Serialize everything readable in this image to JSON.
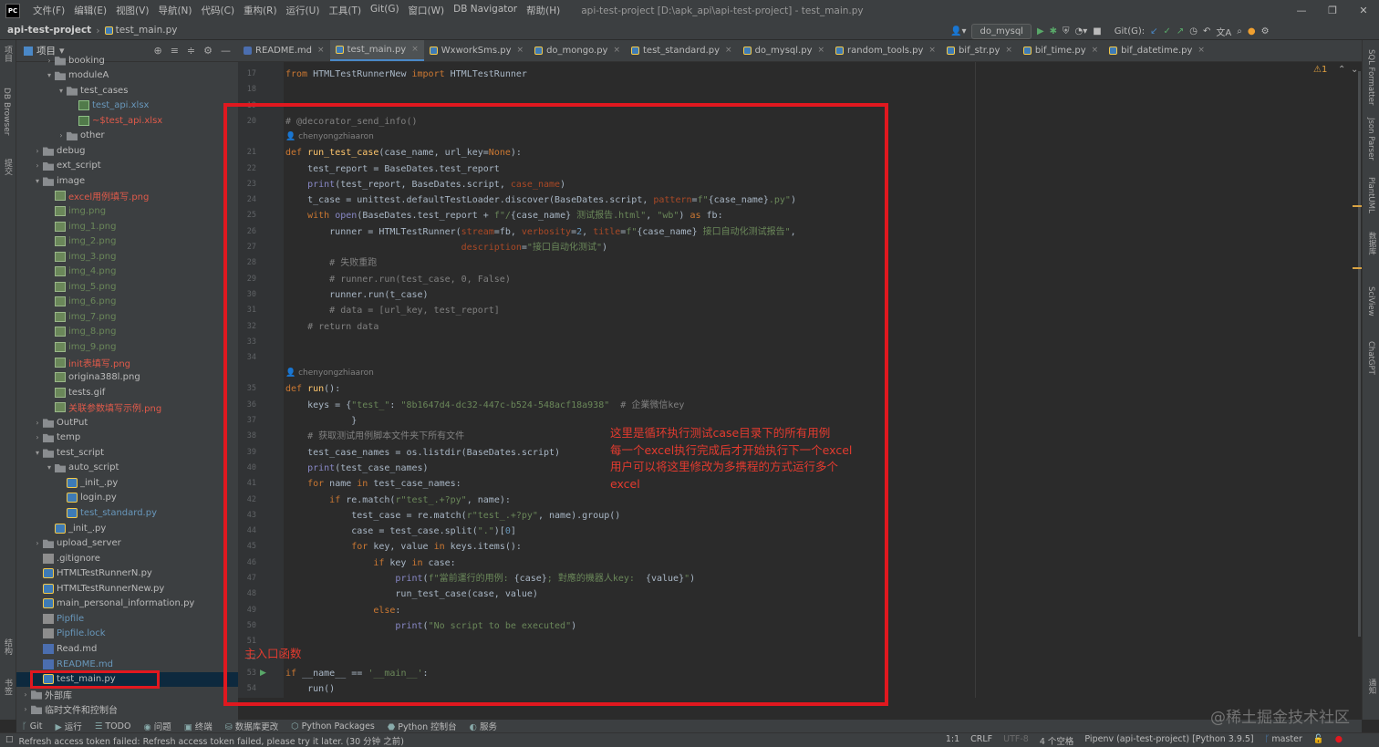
{
  "menubar": {
    "logo": "PC",
    "items": [
      "文件(F)",
      "编辑(E)",
      "视图(V)",
      "导航(N)",
      "代码(C)",
      "重构(R)",
      "运行(U)",
      "工具(T)",
      "Git(G)",
      "窗口(W)",
      "DB Navigator",
      "帮助(H)"
    ],
    "window_title": "api-test-project [D:\\apk_api\\api-test-project] - test_main.py"
  },
  "navbar": {
    "project": "api-test-project",
    "file": "test_main.py"
  },
  "toolbar_right": {
    "run_config": "do_mysql",
    "git_label": "Git(G):"
  },
  "left_strip": {
    "items": [
      "项目",
      "DB Browser",
      "提交",
      "结构",
      "书签"
    ]
  },
  "project_panel": {
    "title": "项目",
    "tree": [
      {
        "label": "booking",
        "icon": "folder",
        "depth": 2,
        "arrow": ">",
        "color": "#bbbbbb"
      },
      {
        "label": "moduleA",
        "icon": "folder",
        "depth": 2,
        "arrow": "v",
        "color": "#bbbbbb"
      },
      {
        "label": "test_cases",
        "icon": "folder",
        "depth": 3,
        "arrow": "v",
        "color": "#bbbbbb"
      },
      {
        "label": "test_api.xlsx",
        "icon": "xls",
        "depth": 4,
        "arrow": "",
        "color": "#6897bb"
      },
      {
        "label": "~$test_api.xlsx",
        "icon": "xls",
        "depth": 4,
        "arrow": "",
        "color": "#e05a4a"
      },
      {
        "label": "other",
        "icon": "folder",
        "depth": 3,
        "arrow": ">",
        "color": "#bbbbbb"
      },
      {
        "label": "debug",
        "icon": "folder",
        "depth": 1,
        "arrow": ">",
        "color": "#bbbbbb"
      },
      {
        "label": "ext_script",
        "icon": "folder",
        "depth": 1,
        "arrow": ">",
        "color": "#bbbbbb"
      },
      {
        "label": "image",
        "icon": "folder",
        "depth": 1,
        "arrow": "v",
        "color": "#bbbbbb"
      },
      {
        "label": "excel用例填写.png",
        "icon": "img",
        "depth": 2,
        "arrow": "",
        "color": "#e05a4a"
      },
      {
        "label": "img.png",
        "icon": "img",
        "depth": 2,
        "arrow": "",
        "color": "#6a8759"
      },
      {
        "label": "img_1.png",
        "icon": "img",
        "depth": 2,
        "arrow": "",
        "color": "#6a8759"
      },
      {
        "label": "img_2.png",
        "icon": "img",
        "depth": 2,
        "arrow": "",
        "color": "#6a8759"
      },
      {
        "label": "img_3.png",
        "icon": "img",
        "depth": 2,
        "arrow": "",
        "color": "#6a8759"
      },
      {
        "label": "img_4.png",
        "icon": "img",
        "depth": 2,
        "arrow": "",
        "color": "#6a8759"
      },
      {
        "label": "img_5.png",
        "icon": "img",
        "depth": 2,
        "arrow": "",
        "color": "#6a8759"
      },
      {
        "label": "img_6.png",
        "icon": "img",
        "depth": 2,
        "arrow": "",
        "color": "#6a8759"
      },
      {
        "label": "img_7.png",
        "icon": "img",
        "depth": 2,
        "arrow": "",
        "color": "#6a8759"
      },
      {
        "label": "img_8.png",
        "icon": "img",
        "depth": 2,
        "arrow": "",
        "color": "#6a8759"
      },
      {
        "label": "img_9.png",
        "icon": "img",
        "depth": 2,
        "arrow": "",
        "color": "#6a8759"
      },
      {
        "label": "init表填写.png",
        "icon": "img",
        "depth": 2,
        "arrow": "",
        "color": "#e05a4a"
      },
      {
        "label": "origina388l.png",
        "icon": "img",
        "depth": 2,
        "arrow": "",
        "color": "#bbbbbb"
      },
      {
        "label": "tests.gif",
        "icon": "img",
        "depth": 2,
        "arrow": "",
        "color": "#bbbbbb"
      },
      {
        "label": "关联参数填写示例.png",
        "icon": "img",
        "depth": 2,
        "arrow": "",
        "color": "#e05a4a"
      },
      {
        "label": "OutPut",
        "icon": "folder",
        "depth": 1,
        "arrow": ">",
        "color": "#bbbbbb"
      },
      {
        "label": "temp",
        "icon": "folder",
        "depth": 1,
        "arrow": ">",
        "color": "#bbbbbb"
      },
      {
        "label": "test_script",
        "icon": "folder",
        "depth": 1,
        "arrow": "v",
        "color": "#bbbbbb"
      },
      {
        "label": "auto_script",
        "icon": "folder",
        "depth": 2,
        "arrow": "v",
        "color": "#bbbbbb"
      },
      {
        "label": "_init_.py",
        "icon": "py",
        "depth": 3,
        "arrow": "",
        "color": "#bbbbbb"
      },
      {
        "label": "login.py",
        "icon": "py",
        "depth": 3,
        "arrow": "",
        "color": "#bbbbbb"
      },
      {
        "label": "test_standard.py",
        "icon": "py",
        "depth": 3,
        "arrow": "",
        "color": "#6897bb"
      },
      {
        "label": "_init_.py",
        "icon": "py",
        "depth": 2,
        "arrow": "",
        "color": "#bbbbbb"
      },
      {
        "label": "upload_server",
        "icon": "folder",
        "depth": 1,
        "arrow": ">",
        "color": "#bbbbbb"
      },
      {
        "label": ".gitignore",
        "icon": "txt",
        "depth": 1,
        "arrow": "",
        "color": "#bbbbbb"
      },
      {
        "label": "HTMLTestRunnerN.py",
        "icon": "py",
        "depth": 1,
        "arrow": "",
        "color": "#bbbbbb"
      },
      {
        "label": "HTMLTestRunnerNew.py",
        "icon": "py",
        "depth": 1,
        "arrow": "",
        "color": "#bbbbbb"
      },
      {
        "label": "main_personal_information.py",
        "icon": "py",
        "depth": 1,
        "arrow": "",
        "color": "#bbbbbb"
      },
      {
        "label": "Pipfile",
        "icon": "txt",
        "depth": 1,
        "arrow": "",
        "color": "#6897bb"
      },
      {
        "label": "Pipfile.lock",
        "icon": "txt",
        "depth": 1,
        "arrow": "",
        "color": "#6897bb"
      },
      {
        "label": "Read.md",
        "icon": "md",
        "depth": 1,
        "arrow": "",
        "color": "#bbbbbb"
      },
      {
        "label": "README.md",
        "icon": "md",
        "depth": 1,
        "arrow": "",
        "color": "#6897bb"
      },
      {
        "label": "test_main.py",
        "icon": "py",
        "depth": 1,
        "arrow": "",
        "color": "#bbbbbb",
        "selected": true
      },
      {
        "label": "外部库",
        "icon": "folder",
        "depth": 0,
        "arrow": ">",
        "color": "#bbbbbb"
      },
      {
        "label": "临时文件和控制台",
        "icon": "folder",
        "depth": 0,
        "arrow": ">",
        "color": "#bbbbbb"
      }
    ]
  },
  "tabs": [
    {
      "label": "README.md",
      "kind": "md",
      "active": false
    },
    {
      "label": "test_main.py",
      "kind": "py",
      "active": true
    },
    {
      "label": "WxworkSms.py",
      "kind": "py",
      "active": false
    },
    {
      "label": "do_mongo.py",
      "kind": "py",
      "active": false
    },
    {
      "label": "test_standard.py",
      "kind": "py",
      "active": false
    },
    {
      "label": "do_mysql.py",
      "kind": "py",
      "active": false
    },
    {
      "label": "random_tools.py",
      "kind": "py",
      "active": false
    },
    {
      "label": "bif_str.py",
      "kind": "py",
      "active": false
    },
    {
      "label": "bif_time.py",
      "kind": "py",
      "active": false
    },
    {
      "label": "bif_datetime.py",
      "kind": "py",
      "active": false
    }
  ],
  "editor": {
    "inspection": "⚠1",
    "lines": [
      {
        "n": "17",
        "html": "<span class=\"kw\">from</span> HTMLTestRunnerNew <span class=\"kw\">import</span> HTMLTestRunner",
        "cls": ""
      },
      {
        "n": "18",
        "html": "",
        "cls": ""
      },
      {
        "n": "19",
        "html": "",
        "cls": ""
      },
      {
        "n": "20",
        "html": "# @decorator_send_info()",
        "cls": "cm"
      },
      {
        "n": "",
        "html": "👤 chenyongzhiaaron",
        "cls": "au"
      },
      {
        "n": "21",
        "html": "<span class=\"kw\">def</span> <span class=\"fn\">run_test_case</span>(case_name, url_key=<span class=\"kw\">None</span>):",
        "cls": ""
      },
      {
        "n": "22",
        "html": "    test_report = BaseDates.test_report",
        "cls": ""
      },
      {
        "n": "23",
        "html": "    <span class=\"bi\">print</span>(test_report, BaseDates.script, <span class=\"pm\">case_name</span>)",
        "cls": ""
      },
      {
        "n": "24",
        "html": "    t_case = unittest.defaultTestLoader.discover(BaseDates.script, <span class=\"pm\">pattern</span>=<span class=\"st\">f\"</span>{case_name}<span class=\"st\">.py\"</span>)",
        "cls": ""
      },
      {
        "n": "25",
        "html": "    <span class=\"kw\">with</span> <span class=\"bi\">open</span>(BaseDates.test_report + <span class=\"st\">f\"/</span>{case_name}<span class=\"st\"> 测试报告.html\"</span>, <span class=\"st\">\"wb\"</span>) <span class=\"kw\">as</span> fb:",
        "cls": ""
      },
      {
        "n": "26",
        "html": "        runner = HTMLTestRunner(<span class=\"pm\">stream</span>=fb, <span class=\"pm\">verbosity</span>=<span class=\"nm\">2</span>, <span class=\"pm\">title</span>=<span class=\"st\">f\"</span>{case_name}<span class=\"st\"> 接口自动化测试报告\"</span>,",
        "cls": ""
      },
      {
        "n": "27",
        "html": "                                <span class=\"pm\">description</span>=<span class=\"st\">\"接口自动化测试\"</span>)",
        "cls": ""
      },
      {
        "n": "28",
        "html": "        # 失败重跑",
        "cls": "cm"
      },
      {
        "n": "29",
        "html": "        # runner.run(test_case, 0, False)",
        "cls": "cm"
      },
      {
        "n": "30",
        "html": "        runner.run(t_case)",
        "cls": ""
      },
      {
        "n": "31",
        "html": "        # data = [url_key, test_report]",
        "cls": "cm"
      },
      {
        "n": "32",
        "html": "    # return data",
        "cls": "cm"
      },
      {
        "n": "33",
        "html": "",
        "cls": ""
      },
      {
        "n": "34",
        "html": "",
        "cls": ""
      },
      {
        "n": "",
        "html": "👤 chenyongzhiaaron",
        "cls": "au"
      },
      {
        "n": "35",
        "html": "<span class=\"kw\">def</span> <span class=\"fn\">run</span>():",
        "cls": ""
      },
      {
        "n": "36",
        "html": "    keys = {<span class=\"st\">\"test_\"</span>: <span class=\"st\">\"8b1647d4-dc32-447c-b524-548acf18a938\"</span>  <span style=\"color:#808080\"># 企業微信key</span>",
        "cls": ""
      },
      {
        "n": "37",
        "html": "            }",
        "cls": ""
      },
      {
        "n": "38",
        "html": "    # 获取测试用例脚本文件夹下所有文件",
        "cls": "cm"
      },
      {
        "n": "39",
        "html": "    test_case_names = os.listdir(BaseDates.script)",
        "cls": ""
      },
      {
        "n": "40",
        "html": "    <span class=\"bi\">print</span>(test_case_names)",
        "cls": ""
      },
      {
        "n": "41",
        "html": "    <span class=\"kw\">for</span> name <span class=\"kw\">in</span> test_case_names:",
        "cls": ""
      },
      {
        "n": "42",
        "html": "        <span class=\"kw\">if</span> re.match(<span class=\"st\">r\"test_.+?py\"</span>, name):",
        "cls": ""
      },
      {
        "n": "43",
        "html": "            test_case = re.match(<span class=\"st\">r\"test_.+?py\"</span>, name).group()",
        "cls": ""
      },
      {
        "n": "44",
        "html": "            case = test_case.split(<span class=\"st\">\".\"</span>)[<span class=\"nm\">0</span>]",
        "cls": ""
      },
      {
        "n": "45",
        "html": "            <span class=\"kw\">for</span> key, value <span class=\"kw\">in</span> keys.items():",
        "cls": ""
      },
      {
        "n": "46",
        "html": "                <span class=\"kw\">if</span> key <span class=\"kw\">in</span> case:",
        "cls": ""
      },
      {
        "n": "47",
        "html": "                    <span class=\"bi\">print</span>(<span class=\"st\">f\"當前運行的用例: </span>{case}<span class=\"st\">; 對應的機器人key:  </span>{value}<span class=\"st\">\"</span>)",
        "cls": ""
      },
      {
        "n": "48",
        "html": "                    run_test_case(case, value)",
        "cls": ""
      },
      {
        "n": "49",
        "html": "                <span class=\"kw\">else</span>:",
        "cls": ""
      },
      {
        "n": "50",
        "html": "                    <span class=\"bi\">print</span>(<span class=\"st\">\"No script to be executed\"</span>)",
        "cls": ""
      },
      {
        "n": "51",
        "html": "",
        "cls": ""
      },
      {
        "n": "52",
        "html": "",
        "cls": ""
      },
      {
        "n": "53",
        "html": "<span class=\"kw\">if</span> __name__ == <span class=\"st\">'__main__'</span>:",
        "cls": ""
      },
      {
        "n": "54",
        "html": "    run()",
        "cls": ""
      }
    ]
  },
  "annotations": {
    "loop_note": "这里是循环执行测试case目录下的所有用例\n每一个excel执行完成后才开始执行下一个excel\n用户可以将这里修改为多携程的方式运行多个\nexcel",
    "main_note": "主入口函数"
  },
  "right_strip": {
    "items": [
      "SQL Formatter",
      "Json Parser",
      "PlantUML",
      "数据库",
      "SciView",
      "ChatGPT",
      "通知"
    ]
  },
  "bottom_tools": [
    "Git",
    "运行",
    "TODO",
    "问题",
    "终端",
    "数据库更改",
    "Python Packages",
    "Python 控制台",
    "服务"
  ],
  "status": {
    "message": "Refresh access token failed: Refresh access token failed, please try it later. (30 分钟 之前)",
    "position": "1:1",
    "line_sep": "CRLF",
    "encoding": "UTF-8",
    "indent": "4 个空格",
    "interpreter": "Pipenv (api-test-project) [Python 3.9.5]",
    "branch": "master"
  },
  "watermark": "@稀土掘金技术社区"
}
